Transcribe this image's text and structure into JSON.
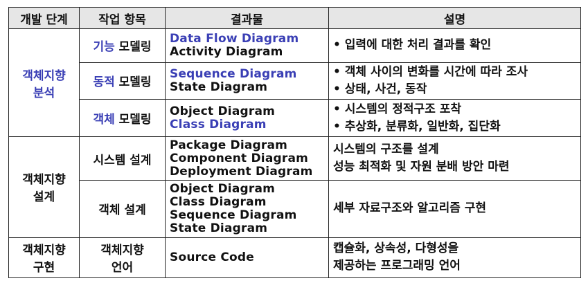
{
  "headers": [
    "개발 단계",
    "작업 항목",
    "결과물",
    "설명"
  ],
  "phases": {
    "analysis": "객체지향\n분석",
    "design": "객체지향\n설계",
    "implementation": "객체지향\n구현"
  },
  "rows": {
    "r1": {
      "item_prefix": "기능",
      "item_suffix": " 모델링",
      "diagrams": [
        "Data Flow Diagram",
        "Activity Diagram"
      ],
      "desc": [
        "입력에 대한 처리 결과를 확인"
      ]
    },
    "r2": {
      "item_prefix": "동적",
      "item_suffix": " 모델링",
      "diagrams": [
        "Sequence Diagram",
        "State Diagram"
      ],
      "desc": [
        "객체 사이의 변화를 시간에 따라 조사",
        "상태, 사건, 동작"
      ]
    },
    "r3": {
      "item_prefix": "객체",
      "item_suffix": " 모델링",
      "diagrams": [
        "Object Diagram",
        "Class Diagram"
      ],
      "desc": [
        "시스템의 정적구조 포착",
        "추상화, 분류화, 일반화, 집단화"
      ]
    },
    "r4": {
      "item": "시스템 설계",
      "diagrams": [
        "Package Diagram",
        "Component Diagram",
        "Deployment Diagram"
      ],
      "desc": [
        "시스템의 구조를 설계",
        "성능 최적화 및 자원 분배 방안 마련"
      ]
    },
    "r5": {
      "item": "객체 설계",
      "diagrams": [
        "Object Diagram",
        "Class Diagram",
        "Sequence Diagram",
        "State Diagram"
      ],
      "desc": [
        "세부 자료구조와 알고리즘 구현"
      ]
    },
    "r6": {
      "item": "객체지향\n언어",
      "diagrams": [
        "Source Code"
      ],
      "desc": [
        "캡슐화, 상속성, 다형성을",
        "제공하는 프로그래밍 언어"
      ]
    }
  },
  "colors": {
    "blue_text": "#3a3fb5",
    "header_bg": "#e6e6e6"
  }
}
